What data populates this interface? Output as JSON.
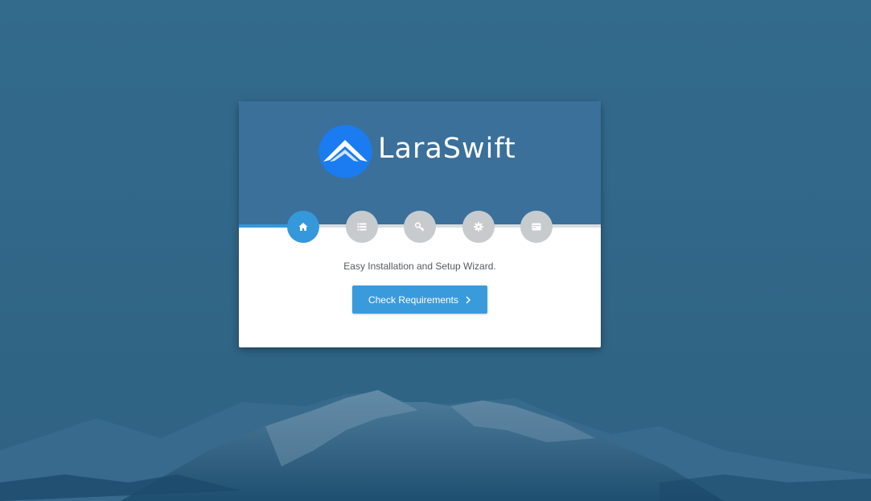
{
  "brand": {
    "name": "LaraSwift",
    "logo_icon": "laraswift-logo-icon"
  },
  "steps": [
    {
      "name": "welcome",
      "icon": "home-icon",
      "active": true
    },
    {
      "name": "requirements",
      "icon": "list-icon",
      "active": false
    },
    {
      "name": "permissions",
      "icon": "key-icon",
      "active": false
    },
    {
      "name": "environment",
      "icon": "gear-icon",
      "active": false
    },
    {
      "name": "finish",
      "icon": "server-icon",
      "active": false
    }
  ],
  "subtitle": "Easy Installation and Setup Wizard.",
  "primary_button": {
    "label": "Check Requirements",
    "icon": "chevron-right-icon"
  },
  "colors": {
    "background": "#34698b",
    "header": "#3a709a",
    "accent": "#3498db",
    "inactive_step": "#c7cbce",
    "logo_blue": "#1a7cf0"
  }
}
